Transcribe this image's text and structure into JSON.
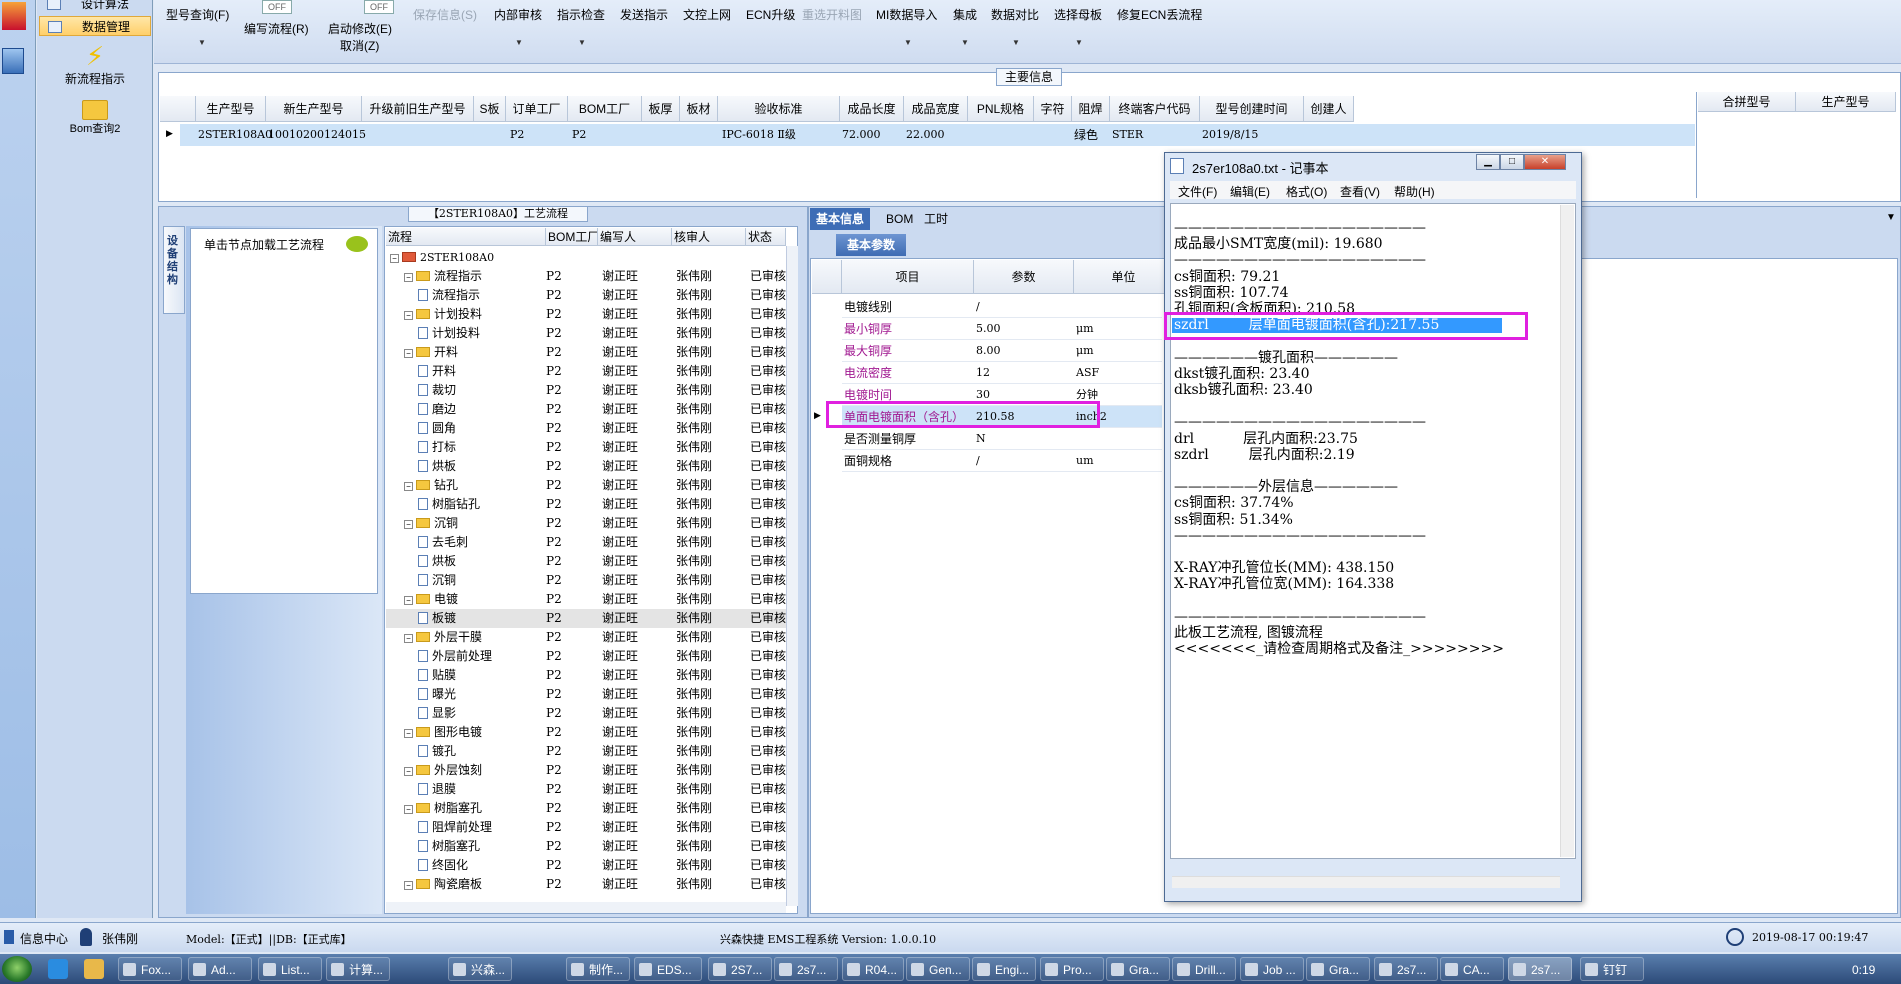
{
  "nav": {
    "top_item": "设计算法",
    "data_mgmt": "数据管理",
    "new_flow": "新流程指示",
    "bom_query": "Bom查询2"
  },
  "toolbar": {
    "items": [
      {
        "label": "型号查询(F)",
        "disabled": false
      },
      {
        "label": "编写流程(R)",
        "disabled": false
      },
      {
        "label": "启动修改(E)",
        "disabled": false
      },
      {
        "label": "取消(Z)",
        "disabled": false
      },
      {
        "label": "保存信息(S)",
        "disabled": true
      },
      {
        "label": "内部审核",
        "disabled": false
      },
      {
        "label": "指示检查",
        "disabled": false
      },
      {
        "label": "发送指示",
        "disabled": false
      },
      {
        "label": "文控上网",
        "disabled": false
      },
      {
        "label": "ECN升级",
        "disabled": false
      },
      {
        "label": "重选开料图",
        "disabled": true
      },
      {
        "label": "MI数据导入",
        "disabled": false
      },
      {
        "label": "集成",
        "disabled": false
      },
      {
        "label": "数据对比",
        "disabled": false
      },
      {
        "label": "选择母板",
        "disabled": false
      },
      {
        "label": "修复ECN丢流程",
        "disabled": false
      }
    ],
    "off1": "OFF",
    "off2": "OFF"
  },
  "main_info": {
    "title": "主要信息",
    "columns": [
      "生产型号",
      "新生产型号",
      "升级前旧生产型号",
      "S板",
      "订单工厂",
      "BOM工厂",
      "板厚",
      "板材",
      "验收标准",
      "成品长度",
      "成品宽度",
      "PNL规格",
      "字符",
      "阻焊",
      "终端客户代码",
      "型号创建时间",
      "创建人"
    ],
    "row": [
      "2STER108A0",
      "10010200124015",
      "",
      "",
      "P2",
      "P2",
      "",
      "",
      "IPC-6018 Ⅱ级",
      "72.000",
      "22.000",
      "",
      "",
      "绿色",
      "STER",
      "2019/8/15",
      ""
    ],
    "right_columns": [
      "合拼型号",
      "生产型号"
    ]
  },
  "flow": {
    "title": "【2STER108A0】工艺流程",
    "side_tab": "设备结构",
    "load_hint": "单击节点加载工艺流程",
    "columns": [
      "流程",
      "BOM工厂",
      "编写人",
      "核审人",
      "状态"
    ],
    "rows": [
      {
        "level": 0,
        "kind": "root",
        "name": "2STER108A0",
        "bom": "",
        "writer": "",
        "reviewer": "",
        "status": ""
      },
      {
        "level": 1,
        "kind": "folder",
        "name": "流程指示",
        "bom": "P2",
        "writer": "谢正旺",
        "reviewer": "张伟刚",
        "status": "已审核"
      },
      {
        "level": 2,
        "kind": "file",
        "name": "流程指示",
        "bom": "P2",
        "writer": "谢正旺",
        "reviewer": "张伟刚",
        "status": "已审核"
      },
      {
        "level": 1,
        "kind": "folder",
        "name": "计划投料",
        "bom": "P2",
        "writer": "谢正旺",
        "reviewer": "张伟刚",
        "status": "已审核"
      },
      {
        "level": 2,
        "kind": "file",
        "name": "计划投料",
        "bom": "P2",
        "writer": "谢正旺",
        "reviewer": "张伟刚",
        "status": "已审核"
      },
      {
        "level": 1,
        "kind": "folder",
        "name": "开料",
        "bom": "P2",
        "writer": "谢正旺",
        "reviewer": "张伟刚",
        "status": "已审核"
      },
      {
        "level": 2,
        "kind": "file",
        "name": "开料",
        "bom": "P2",
        "writer": "谢正旺",
        "reviewer": "张伟刚",
        "status": "已审核"
      },
      {
        "level": 2,
        "kind": "file",
        "name": "裁切",
        "bom": "P2",
        "writer": "谢正旺",
        "reviewer": "张伟刚",
        "status": "已审核"
      },
      {
        "level": 2,
        "kind": "file",
        "name": "磨边",
        "bom": "P2",
        "writer": "谢正旺",
        "reviewer": "张伟刚",
        "status": "已审核"
      },
      {
        "level": 2,
        "kind": "file",
        "name": "圆角",
        "bom": "P2",
        "writer": "谢正旺",
        "reviewer": "张伟刚",
        "status": "已审核"
      },
      {
        "level": 2,
        "kind": "file",
        "name": "打标",
        "bom": "P2",
        "writer": "谢正旺",
        "reviewer": "张伟刚",
        "status": "已审核"
      },
      {
        "level": 2,
        "kind": "file",
        "name": "烘板",
        "bom": "P2",
        "writer": "谢正旺",
        "reviewer": "张伟刚",
        "status": "已审核"
      },
      {
        "level": 1,
        "kind": "folder",
        "name": "钻孔",
        "bom": "P2",
        "writer": "谢正旺",
        "reviewer": "张伟刚",
        "status": "已审核"
      },
      {
        "level": 2,
        "kind": "file",
        "name": "树脂钻孔",
        "bom": "P2",
        "writer": "谢正旺",
        "reviewer": "张伟刚",
        "status": "已审核"
      },
      {
        "level": 1,
        "kind": "folder",
        "name": "沉铜",
        "bom": "P2",
        "writer": "谢正旺",
        "reviewer": "张伟刚",
        "status": "已审核"
      },
      {
        "level": 2,
        "kind": "file",
        "name": "去毛刺",
        "bom": "P2",
        "writer": "谢正旺",
        "reviewer": "张伟刚",
        "status": "已审核"
      },
      {
        "level": 2,
        "kind": "file",
        "name": "烘板",
        "bom": "P2",
        "writer": "谢正旺",
        "reviewer": "张伟刚",
        "status": "已审核"
      },
      {
        "level": 2,
        "kind": "file",
        "name": "沉铜",
        "bom": "P2",
        "writer": "谢正旺",
        "reviewer": "张伟刚",
        "status": "已审核"
      },
      {
        "level": 1,
        "kind": "folder",
        "name": "电镀",
        "bom": "P2",
        "writer": "谢正旺",
        "reviewer": "张伟刚",
        "status": "已审核"
      },
      {
        "level": 2,
        "kind": "file",
        "name": "板镀",
        "bom": "P2",
        "writer": "谢正旺",
        "reviewer": "张伟刚",
        "status": "已审核",
        "selected": true
      },
      {
        "level": 1,
        "kind": "folder",
        "name": "外层干膜",
        "bom": "P2",
        "writer": "谢正旺",
        "reviewer": "张伟刚",
        "status": "已审核"
      },
      {
        "level": 2,
        "kind": "file",
        "name": "外层前处理",
        "bom": "P2",
        "writer": "谢正旺",
        "reviewer": "张伟刚",
        "status": "已审核"
      },
      {
        "level": 2,
        "kind": "file",
        "name": "贴膜",
        "bom": "P2",
        "writer": "谢正旺",
        "reviewer": "张伟刚",
        "status": "已审核"
      },
      {
        "level": 2,
        "kind": "file",
        "name": "曝光",
        "bom": "P2",
        "writer": "谢正旺",
        "reviewer": "张伟刚",
        "status": "已审核"
      },
      {
        "level": 2,
        "kind": "file",
        "name": "显影",
        "bom": "P2",
        "writer": "谢正旺",
        "reviewer": "张伟刚",
        "status": "已审核"
      },
      {
        "level": 1,
        "kind": "folder",
        "name": "图形电镀",
        "bom": "P2",
        "writer": "谢正旺",
        "reviewer": "张伟刚",
        "status": "已审核"
      },
      {
        "level": 2,
        "kind": "file",
        "name": "镀孔",
        "bom": "P2",
        "writer": "谢正旺",
        "reviewer": "张伟刚",
        "status": "已审核"
      },
      {
        "level": 1,
        "kind": "folder",
        "name": "外层蚀刻",
        "bom": "P2",
        "writer": "谢正旺",
        "reviewer": "张伟刚",
        "status": "已审核"
      },
      {
        "level": 2,
        "kind": "file",
        "name": "退膜",
        "bom": "P2",
        "writer": "谢正旺",
        "reviewer": "张伟刚",
        "status": "已审核"
      },
      {
        "level": 1,
        "kind": "folder",
        "name": "树脂塞孔",
        "bom": "P2",
        "writer": "谢正旺",
        "reviewer": "张伟刚",
        "status": "已审核"
      },
      {
        "level": 2,
        "kind": "file",
        "name": "阻焊前处理",
        "bom": "P2",
        "writer": "谢正旺",
        "reviewer": "张伟刚",
        "status": "已审核"
      },
      {
        "level": 2,
        "kind": "file",
        "name": "树脂塞孔",
        "bom": "P2",
        "writer": "谢正旺",
        "reviewer": "张伟刚",
        "status": "已审核"
      },
      {
        "level": 2,
        "kind": "file",
        "name": "终固化",
        "bom": "P2",
        "writer": "谢正旺",
        "reviewer": "张伟刚",
        "status": "已审核"
      },
      {
        "level": 1,
        "kind": "folder",
        "name": "陶瓷磨板",
        "bom": "P2",
        "writer": "谢正旺",
        "reviewer": "张伟刚",
        "status": "已审核"
      }
    ]
  },
  "basic": {
    "tabs": [
      "基本信息",
      "BOM",
      "工时"
    ],
    "subtab": "基本参数",
    "columns": [
      "项目",
      "参数",
      "单位"
    ],
    "rows": [
      {
        "item": "电镀线别",
        "value": "/",
        "unit": "",
        "purple": false
      },
      {
        "item": "最小铜厚",
        "value": "5.00",
        "unit": "μm",
        "purple": true
      },
      {
        "item": "最大铜厚",
        "value": "8.00",
        "unit": "μm",
        "purple": true
      },
      {
        "item": "电流密度",
        "value": "12",
        "unit": "ASF",
        "purple": true
      },
      {
        "item": "电镀时间",
        "value": "30",
        "unit": "分钟",
        "purple": true
      },
      {
        "item": "单面电镀面积（含孔）",
        "value": "210.58",
        "unit": "inch2",
        "purple": true,
        "highlight": true
      },
      {
        "item": "是否测量铜厚",
        "value": "N",
        "unit": "",
        "purple": false
      },
      {
        "item": "面铜规格",
        "value": "/",
        "unit": "um",
        "purple": false
      }
    ]
  },
  "notepad": {
    "title": "2s7er108a0.txt - 记事本",
    "menu": [
      "文件(F)",
      "编辑(E)",
      "格式(O)",
      "查看(V)",
      "帮助(H)"
    ],
    "lines": [
      "——————————————————",
      "成品最小SMT宽度(mil): 19.680",
      "——————————————————",
      "cs铜面积: 79.21",
      "ss铜面积: 107.74",
      "孔铜面积(含板面积): 210.58",
      "szdrl         层单面电镀面积(含孔):217.55",
      "",
      "——————镀孔面积——————",
      "dkst镀孔面积: 23.40",
      "dksb镀孔面积: 23.40",
      "",
      "——————————————————",
      "drl           层孔内面积:23.75",
      "szdrl         层孔内面积:2.19",
      "",
      "——————外层信息——————",
      "cs铜面积: 37.74%",
      "ss铜面积: 51.34%",
      "——————————————————",
      "",
      "X-RAY冲孔管位长(MM): 438.150",
      "X-RAY冲孔管位宽(MM): 164.338",
      "",
      "——————————————————",
      "此板工艺流程, 图镀流程",
      "<<<<<<<_请检查周期格式及备注_>>>>>>>>"
    ]
  },
  "status": {
    "info_center": "信息中心",
    "user": "张伟刚",
    "model": "Model:【正式】||DB:【正式库】",
    "system": "兴森快捷 EMS工程系统 Version: 1.0.0.10",
    "datetime": "2019-08-17 00:19:47"
  },
  "taskbar": {
    "items": [
      "Fox...",
      "Ad...",
      "List...",
      "计算...",
      "兴森...",
      "制作...",
      "EDS...",
      "2S7...",
      "2s7...",
      "R04...",
      "Gen...",
      "Engi...",
      "Pro...",
      "Gra...",
      "Drill...",
      "Job ...",
      "Gra...",
      "2s7...",
      "CA...",
      "2s7...",
      "钉钉"
    ],
    "clock": "0:19"
  }
}
